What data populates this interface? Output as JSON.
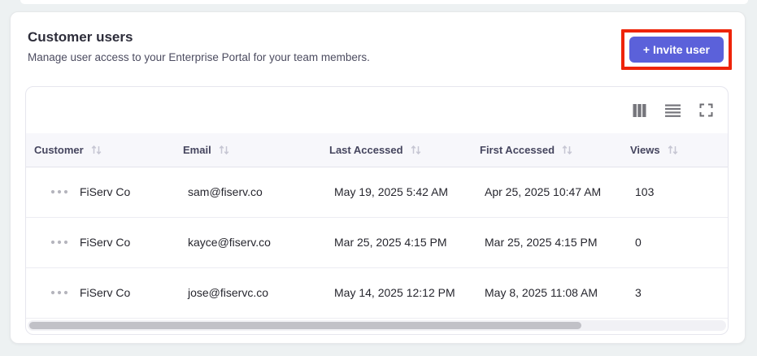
{
  "header": {
    "title": "Customer users",
    "subtitle": "Manage user access to your Enterprise Portal for your team members.",
    "invite_button_label": "+ Invite user"
  },
  "toolbar": {
    "icons": [
      "columns-icon",
      "rows-icon",
      "fullscreen-icon"
    ]
  },
  "table": {
    "columns": [
      {
        "label": "Customer",
        "sortable": true
      },
      {
        "label": "Email",
        "sortable": true
      },
      {
        "label": "Last Accessed",
        "sortable": true
      },
      {
        "label": "First Accessed",
        "sortable": true
      },
      {
        "label": "Views",
        "sortable": true
      }
    ],
    "rows": [
      {
        "customer": "FiServ Co",
        "email": "sam@fiserv.co",
        "last_accessed": "May 19, 2025 5:42 AM",
        "first_accessed": "Apr 25, 2025 10:47 AM",
        "views": "103"
      },
      {
        "customer": "FiServ Co",
        "email": "kayce@fiserv.co",
        "last_accessed": "Mar 25, 2025 4:15 PM",
        "first_accessed": "Mar 25, 2025 4:15 PM",
        "views": "0"
      },
      {
        "customer": "FiServ Co",
        "email": "jose@fiservc.co",
        "last_accessed": "May 14, 2025 12:12 PM",
        "first_accessed": "May 8, 2025 11:08 AM",
        "views": "3"
      }
    ]
  },
  "colors": {
    "accent": "#5b61da",
    "annotation": "#ee2409"
  }
}
